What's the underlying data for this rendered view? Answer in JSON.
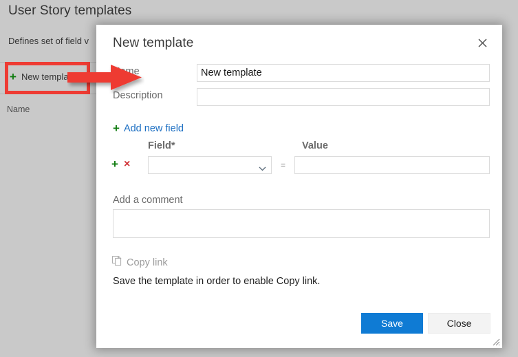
{
  "background_page": {
    "title": "User Story templates",
    "subtitle": "Defines set of field v",
    "new_template_button": "New template",
    "plus_glyph": "+",
    "column_header_name": "Name"
  },
  "dialog": {
    "title": "New template",
    "close_icon": "close-icon",
    "fields": {
      "name_label": "Name",
      "name_value": "New template",
      "name_placeholder": "",
      "description_label": "Description",
      "description_value": "",
      "description_placeholder": ""
    },
    "add_new_field": {
      "plus_glyph": "+",
      "label": "Add new field"
    },
    "field_table": {
      "header_field": "Field*",
      "header_value": "Value",
      "row": {
        "add_glyph": "+",
        "remove_glyph": "×",
        "select_value": "",
        "equals_glyph": "=",
        "value_input": "",
        "value_placeholder": ""
      }
    },
    "comment": {
      "label": "Add a comment",
      "value": "",
      "placeholder": ""
    },
    "copy_link": {
      "icon": "copy-icon",
      "label": "Copy link",
      "hint": "Save the template in order to enable Copy link."
    },
    "footer": {
      "save_label": "Save",
      "close_label": "Close"
    },
    "resize_grip": "resize-grip-icon"
  },
  "annotations": {
    "highlight_color": "#ee3b33",
    "arrow_color": "#ee3b33",
    "box_target": "New template"
  },
  "colors": {
    "accent_blue": "#0f7bd4",
    "link_blue": "#1b6ec2",
    "green_plus": "#107c10",
    "red_x": "#d13438",
    "page_backdrop": "#c9c9c9"
  }
}
